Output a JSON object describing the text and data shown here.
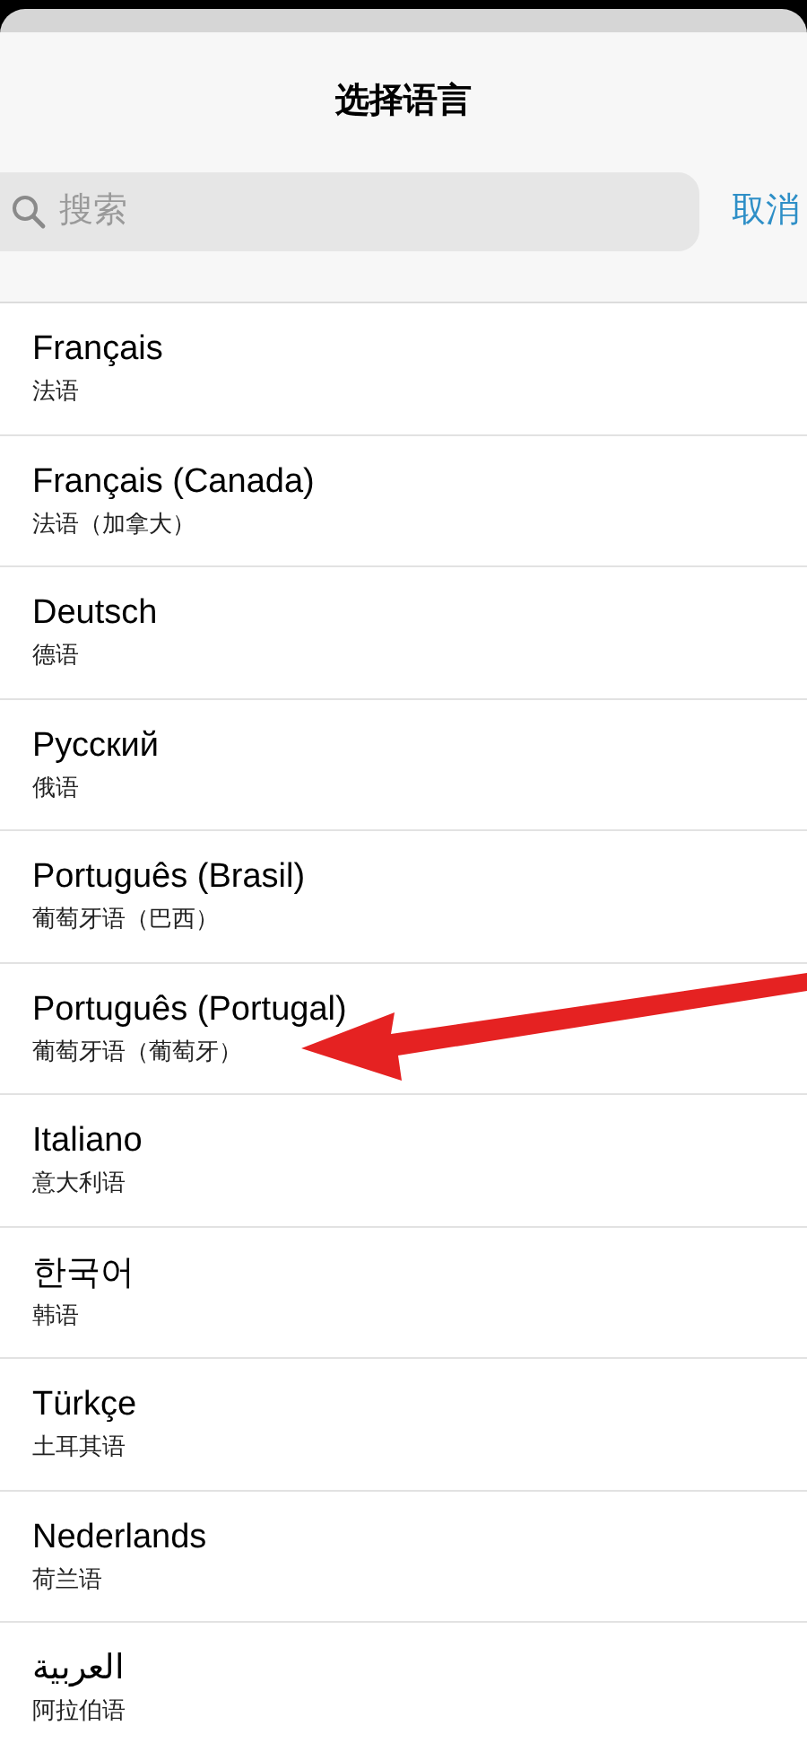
{
  "title": "选择语言",
  "search": {
    "placeholder": "搜索"
  },
  "cancel": "取消",
  "languages": [
    {
      "name": "Français",
      "native": "法语"
    },
    {
      "name": "Français (Canada)",
      "native": "法语（加拿大）"
    },
    {
      "name": "Deutsch",
      "native": "德语"
    },
    {
      "name": "Русский",
      "native": "俄语"
    },
    {
      "name": "Português (Brasil)",
      "native": "葡萄牙语（巴西）"
    },
    {
      "name": "Português (Portugal)",
      "native": "葡萄牙语（葡萄牙）"
    },
    {
      "name": "Italiano",
      "native": "意大利语"
    },
    {
      "name": "한국어",
      "native": "韩语"
    },
    {
      "name": "Türkçe",
      "native": "土耳其语"
    },
    {
      "name": "Nederlands",
      "native": "荷兰语"
    },
    {
      "name": "العربية",
      "native": "阿拉伯语"
    }
  ]
}
